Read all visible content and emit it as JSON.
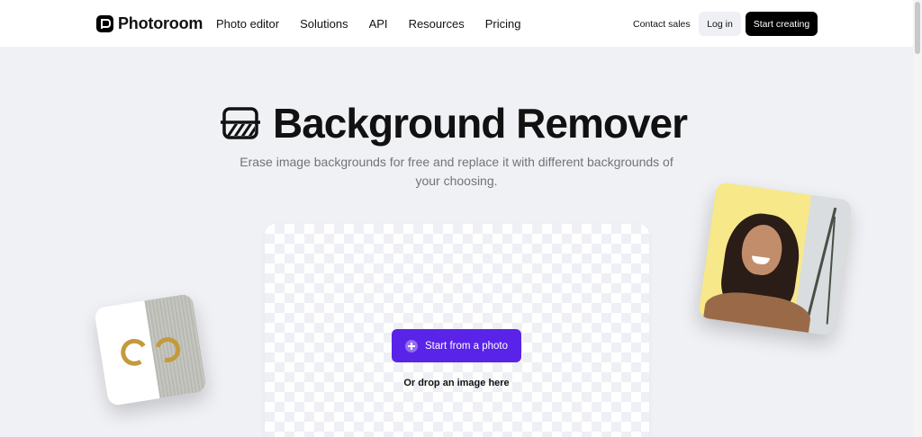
{
  "nav": {
    "brand": "Photoroom",
    "links": [
      "Photo editor",
      "Solutions",
      "API",
      "Resources",
      "Pricing"
    ],
    "contact": "Contact sales",
    "login": "Log in",
    "cta": "Start creating"
  },
  "hero": {
    "title": "Background Remover",
    "subtitle_line1": "Erase image backgrounds for free and replace it with different backgrounds of",
    "subtitle_line2": "your choosing."
  },
  "upload": {
    "button": "Start from a photo",
    "drop": "Or drop an image here"
  },
  "colors": {
    "accent": "#5a23e8",
    "page_bg": "#f0f1f5",
    "nav_bg": "#ffffff",
    "cta_bg": "#000000"
  },
  "icons": {
    "brand": "photoroom-logo-icon",
    "hero": "background-remover-icon",
    "upload": "plus-circle-icon"
  }
}
